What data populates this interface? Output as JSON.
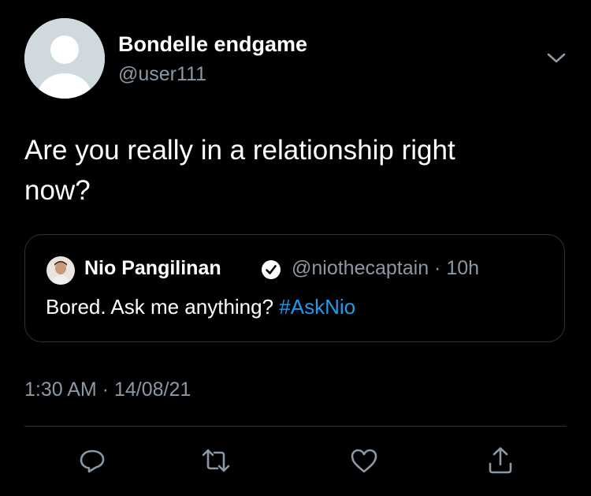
{
  "tweet": {
    "author_name": "Bondelle endgame",
    "author_handle": "@user111",
    "text": "Are you really in a relationship right now?",
    "timestamp": "1:30 AM · 14/08/21"
  },
  "quoted_tweet": {
    "author_name": "Nio Pangilinan",
    "verified": true,
    "handle_and_time": "@niothecaptain · 10h",
    "text": "Bored. Ask me anything? ",
    "hashtag": "#AskNio"
  },
  "icons": {
    "caret": "chevron-down-icon",
    "verified": "verified-badge-icon",
    "reply": "reply-icon",
    "retweet": "retweet-icon",
    "like": "heart-icon",
    "share": "share-icon"
  },
  "colors": {
    "background": "#000000",
    "primary_text": "#ffffff",
    "secondary_text": "#8b98a5",
    "link": "#1d9bf0",
    "border": "#2f3336"
  }
}
